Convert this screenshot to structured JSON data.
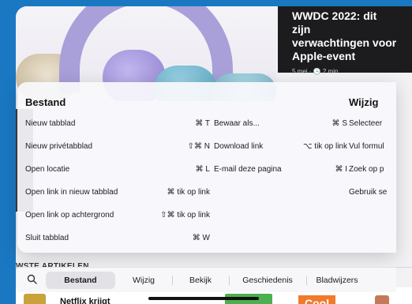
{
  "background_article": {
    "title": "WWDC 2022: dit zijn\nverwachtingen voor\nApple-event",
    "meta": "5 mei · 🕒 2 min.",
    "section_label": "WSTE ARTIKELEN",
    "bottom_headline": "Netflix krijgt",
    "bottom_tag": "Cool"
  },
  "menu": {
    "columns": [
      {
        "heading": "Bestand",
        "items": [
          {
            "label": "Nieuw tabblad",
            "shortcut": "⌘ T"
          },
          {
            "label": "Nieuw privétabblad",
            "shortcut": "⇧⌘ N"
          },
          {
            "label": "Open locatie",
            "shortcut": "⌘ L"
          },
          {
            "label": "Open link in nieuw tabblad",
            "shortcut": "⌘ tik op link"
          },
          {
            "label": "Open link op achtergrond",
            "shortcut": "⇧⌘ tik op link"
          },
          {
            "label": "Sluit tabblad",
            "shortcut": "⌘ W"
          }
        ]
      },
      {
        "heading": "",
        "items": [
          {
            "label": "Bewaar als...",
            "shortcut": "⌘ S"
          },
          {
            "label": "Download link",
            "shortcut": "⌥ tik op link"
          },
          {
            "label": "E-mail deze pagina",
            "shortcut": "⌘ I"
          }
        ]
      },
      {
        "heading": "Wijzig",
        "items": [
          {
            "label": "Selecteer",
            "shortcut": ""
          },
          {
            "label": "Vul formul",
            "shortcut": ""
          },
          {
            "label": "Zoek op p",
            "shortcut": ""
          },
          {
            "label": "Gebruik se",
            "shortcut": ""
          }
        ]
      }
    ]
  },
  "menu_bar": {
    "search_icon": "search-icon",
    "tabs": [
      "Bestand",
      "Wijzig",
      "Bekijk",
      "Geschiedenis",
      "Bladwijzers"
    ],
    "active_tab": "Bestand"
  }
}
